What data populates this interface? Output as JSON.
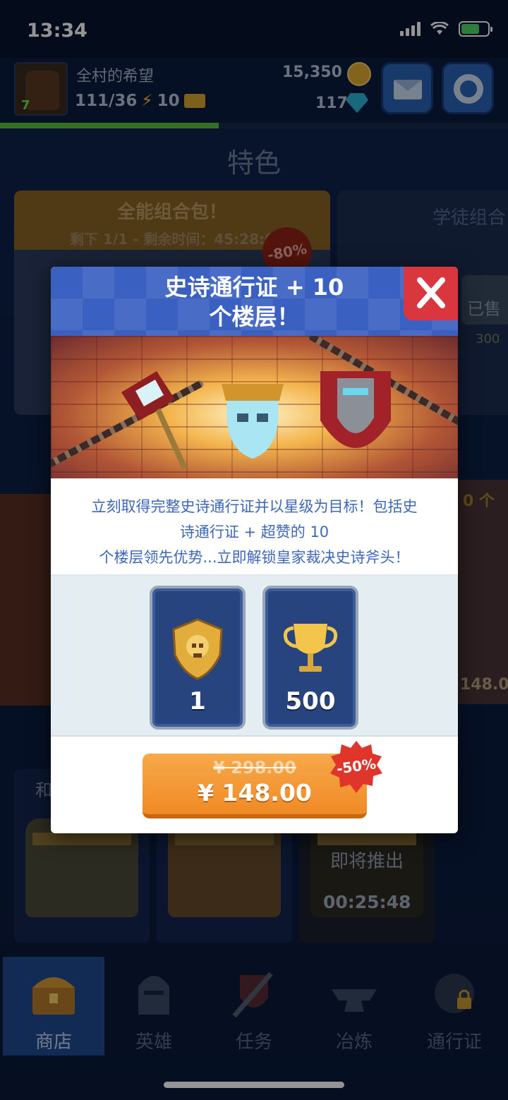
{
  "status_bar": {
    "time": "13:34"
  },
  "player": {
    "name": "全村的希望",
    "level": "7",
    "energy": "111/36",
    "energy_extra": "10",
    "gold": "15,350",
    "gems": "117",
    "xp_fraction": 0.43
  },
  "page_title": "特色",
  "background_cards": {
    "bundle_title": "全能组合包！",
    "bundle_timer": "剩下 1/1 - 剩余时间：45:28:0",
    "bundle_discount": "-80%",
    "apprentice_title": "学徒组合",
    "apprentice_sold": "已售",
    "apprentice_price": "300",
    "pass_floor_label": "0 个",
    "pass_price": "148.0",
    "chest_label": "和",
    "coming_soon": "即将推出",
    "coming_timer": "00:25:48"
  },
  "tabs": [
    {
      "label": "商店",
      "icon": "chest-icon"
    },
    {
      "label": "英雄",
      "icon": "helmet-icon"
    },
    {
      "label": "任务",
      "icon": "sword-shield-icon"
    },
    {
      "label": "冶炼",
      "icon": "anvil-icon"
    },
    {
      "label": "通行证",
      "icon": "locked-pass-icon"
    }
  ],
  "modal": {
    "title_line1": "史诗通行证 + 10",
    "title_line2": "个楼层！",
    "description_line1": "立刻取得完整史诗通行证并以星级为目标！包括史",
    "description_line2": "诗通行证 + 超赞的 10",
    "description_line3": "个楼层领先优势...立即解锁皇家裁决史诗斧头！",
    "rewards": [
      {
        "icon": "skull-shield-icon",
        "value": "1"
      },
      {
        "icon": "trophy-icon",
        "value": "500"
      }
    ],
    "old_price": "¥ 298.00",
    "new_price": "¥ 148.00",
    "discount": "-50%"
  },
  "colors": {
    "header_blue": "#3a61c2",
    "close_red": "#d9363e",
    "button_orange": "#f08a25",
    "text_blue": "#3e67b8",
    "reward_card_blue": "#27447f"
  }
}
